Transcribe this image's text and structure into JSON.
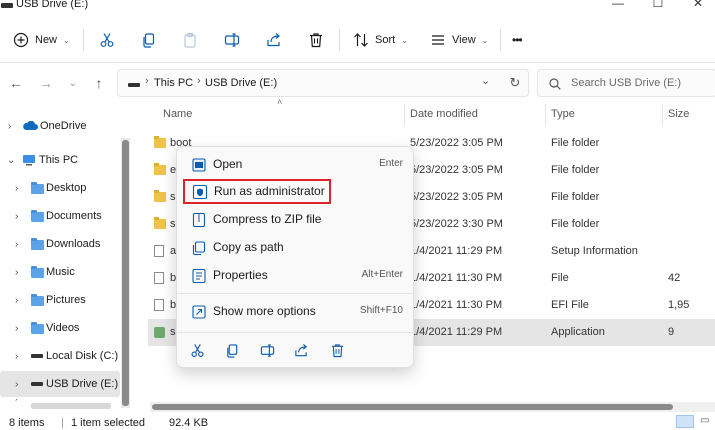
{
  "window": {
    "title": "USB Drive (E:)"
  },
  "toolbar": {
    "new_label": "New",
    "sort_label": "Sort",
    "view_label": "View",
    "more_label": "•••"
  },
  "address": {
    "crumbs": [
      "This PC",
      "USB Drive (E:)"
    ],
    "search_placeholder": "Search USB Drive (E:)"
  },
  "sidebar": {
    "items": [
      {
        "label": "OneDrive",
        "icon": "cloud-icon"
      },
      {
        "label": "This PC",
        "icon": "computer-icon"
      },
      {
        "label": "Desktop",
        "icon": "folder-icon"
      },
      {
        "label": "Documents",
        "icon": "folder-icon"
      },
      {
        "label": "Downloads",
        "icon": "folder-icon"
      },
      {
        "label": "Music",
        "icon": "folder-icon"
      },
      {
        "label": "Pictures",
        "icon": "folder-icon"
      },
      {
        "label": "Videos",
        "icon": "folder-icon"
      },
      {
        "label": "Local Disk (C:)",
        "icon": "drive-icon"
      },
      {
        "label": "USB Drive (E:)",
        "icon": "drive-icon"
      }
    ]
  },
  "files": {
    "columns": [
      "Name",
      "Date modified",
      "Type",
      "Size"
    ],
    "rows": [
      {
        "name": "boot",
        "date": "5/23/2022 3:05 PM",
        "type": "File folder",
        "size": "",
        "icon": "folder-icon"
      },
      {
        "name": "e",
        "date": "5/23/2022 3:05 PM",
        "type": "File folder",
        "size": "",
        "icon": "folder-icon"
      },
      {
        "name": "s",
        "date": "5/23/2022 3:05 PM",
        "type": "File folder",
        "size": "",
        "icon": "folder-icon"
      },
      {
        "name": "s",
        "date": "5/23/2022 3:30 PM",
        "type": "File folder",
        "size": "",
        "icon": "folder-icon"
      },
      {
        "name": "a",
        "date": "1/4/2021 11:29 PM",
        "type": "Setup Information",
        "size": "",
        "icon": "setup-file-icon"
      },
      {
        "name": "b",
        "date": "1/4/2021 11:30 PM",
        "type": "File",
        "size": "42",
        "icon": "file-icon"
      },
      {
        "name": "b",
        "date": "1/4/2021 11:30 PM",
        "type": "EFI File",
        "size": "1,95",
        "icon": "file-icon"
      },
      {
        "name": "s",
        "date": "1/4/2021 11:29 PM",
        "type": "Application",
        "size": "9",
        "icon": "setup-app-icon"
      }
    ]
  },
  "context_menu": {
    "items": [
      {
        "label": "Open",
        "shortcut": "Enter",
        "icon": "open-icon"
      },
      {
        "label": "Run as administrator",
        "shortcut": "",
        "icon": "shield-icon"
      },
      {
        "label": "Compress to ZIP file",
        "shortcut": "",
        "icon": "zip-icon"
      },
      {
        "label": "Copy as path",
        "shortcut": "",
        "icon": "copy-path-icon"
      },
      {
        "label": "Properties",
        "shortcut": "Alt+Enter",
        "icon": "properties-icon"
      },
      {
        "label": "Show more options",
        "shortcut": "Shift+F10",
        "icon": "more-options-icon"
      }
    ],
    "bottom_actions": [
      "cut-icon",
      "copy-icon",
      "rename-icon",
      "share-icon",
      "delete-icon"
    ],
    "highlight_color": "#d9252a"
  },
  "status": {
    "items_count": "8 items",
    "selection": "1 item selected",
    "size": "92.4 KB"
  },
  "colors": {
    "accent": "#0067c0",
    "folder": "#f1c24b",
    "selected_row": "#e5e5e5"
  }
}
